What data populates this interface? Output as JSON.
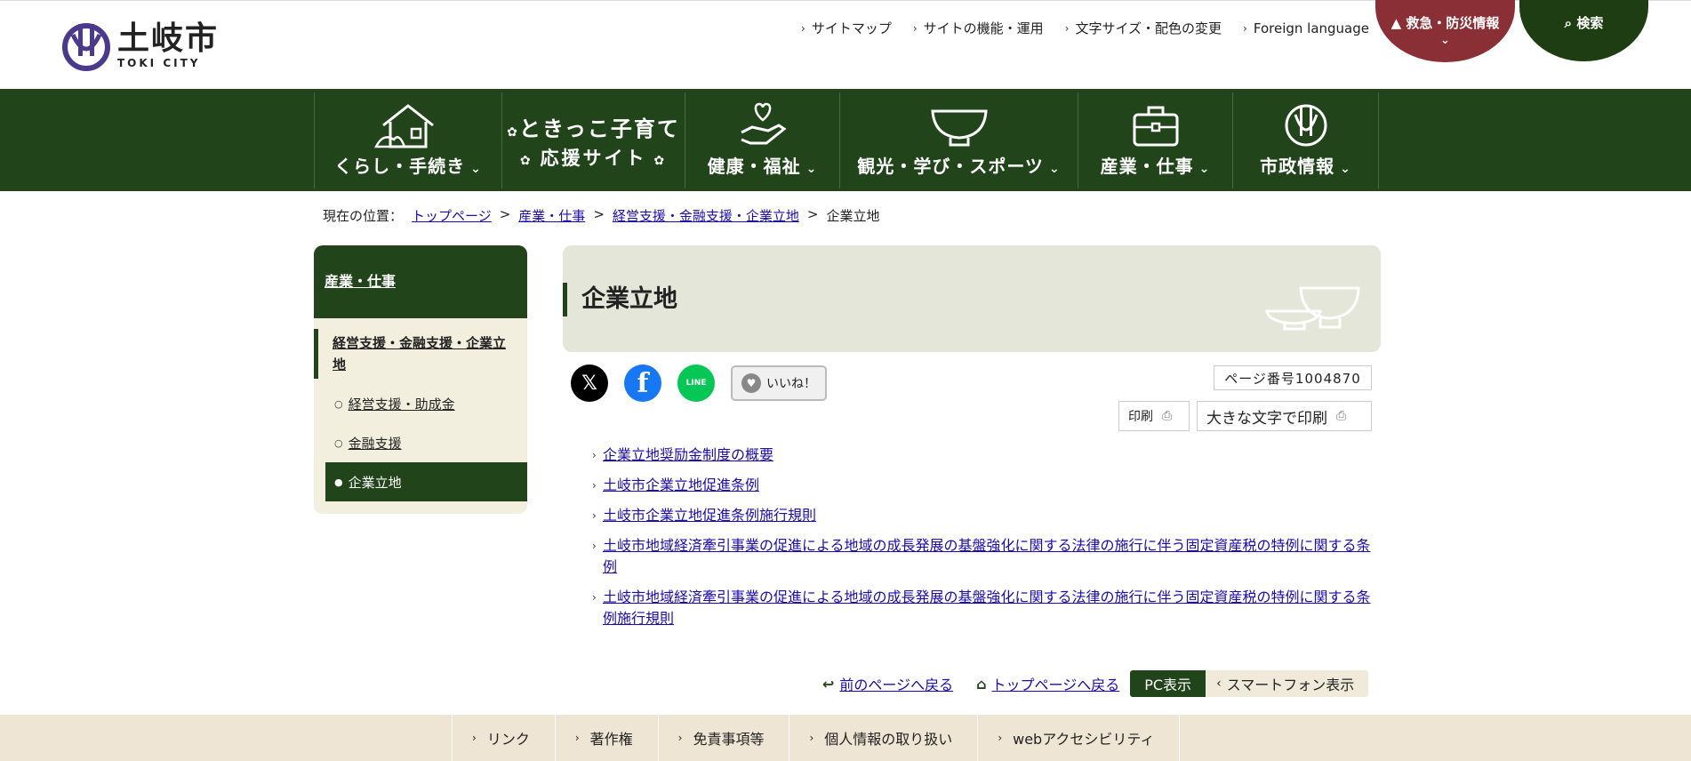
{
  "header": {
    "logo_jp": "土岐市",
    "logo_en": "TOKI CITY",
    "util_links": [
      "サイトマップ",
      "サイトの機能・運用",
      "文字サイズ・配色の変更",
      "Foreign language"
    ],
    "emergency_label": "救急・防災情報",
    "search_label": "検索"
  },
  "gnav": {
    "items": [
      "くらし・手続き",
      "健康・福祉",
      "観光・学び・スポーツ",
      "産業・仕事",
      "市政情報"
    ],
    "kosodate_line1": "ときっこ子育て",
    "kosodate_line2": "応援サイト"
  },
  "breadcrumb": {
    "prefix": "現在の位置：",
    "items": [
      "トップページ",
      "産業・仕事",
      "経営支援・金融支援・企業立地"
    ],
    "current": "企業立地"
  },
  "sidebar": {
    "heading": "産業・仕事",
    "sub": "経営支援・金融支援・企業立地",
    "items": [
      "経営支援・助成金",
      "金融支援",
      "企業立地"
    ]
  },
  "main": {
    "title": "企業立地",
    "like_label": "いいね！",
    "page_number": "ページ番号1004870",
    "print_label": "印刷",
    "print_large_label": "大きな文字で印刷",
    "links": [
      "企業立地奨励金制度の概要",
      "土岐市企業立地促進条例",
      "土岐市企業立地促進条例施行規則",
      "土岐市地域経済牽引事業の促進による地域の成長発展の基盤強化に関する法律の施行に伴う固定資産税の特例に関する条例",
      "土岐市地域経済牽引事業の促進による地域の成長発展の基盤強化に関する法律の施行に伴う固定資産税の特例に関する条例施行規則"
    ]
  },
  "page_nav": {
    "back": "前のページへ戻る",
    "top": "トップページへ戻る",
    "pc": "PC表示",
    "sp": "スマートフォン表示"
  },
  "footer": {
    "links": [
      "リンク",
      "著作権",
      "免責事項等",
      "個人情報の取り扱い",
      "webアクセシビリティ"
    ]
  },
  "colors": {
    "primary_green": "#21441a",
    "emergency_red": "#8b2f36",
    "sidebar_bg": "#f3efdf",
    "footer_bg": "#efe5d4",
    "link": "#1a0dab"
  }
}
